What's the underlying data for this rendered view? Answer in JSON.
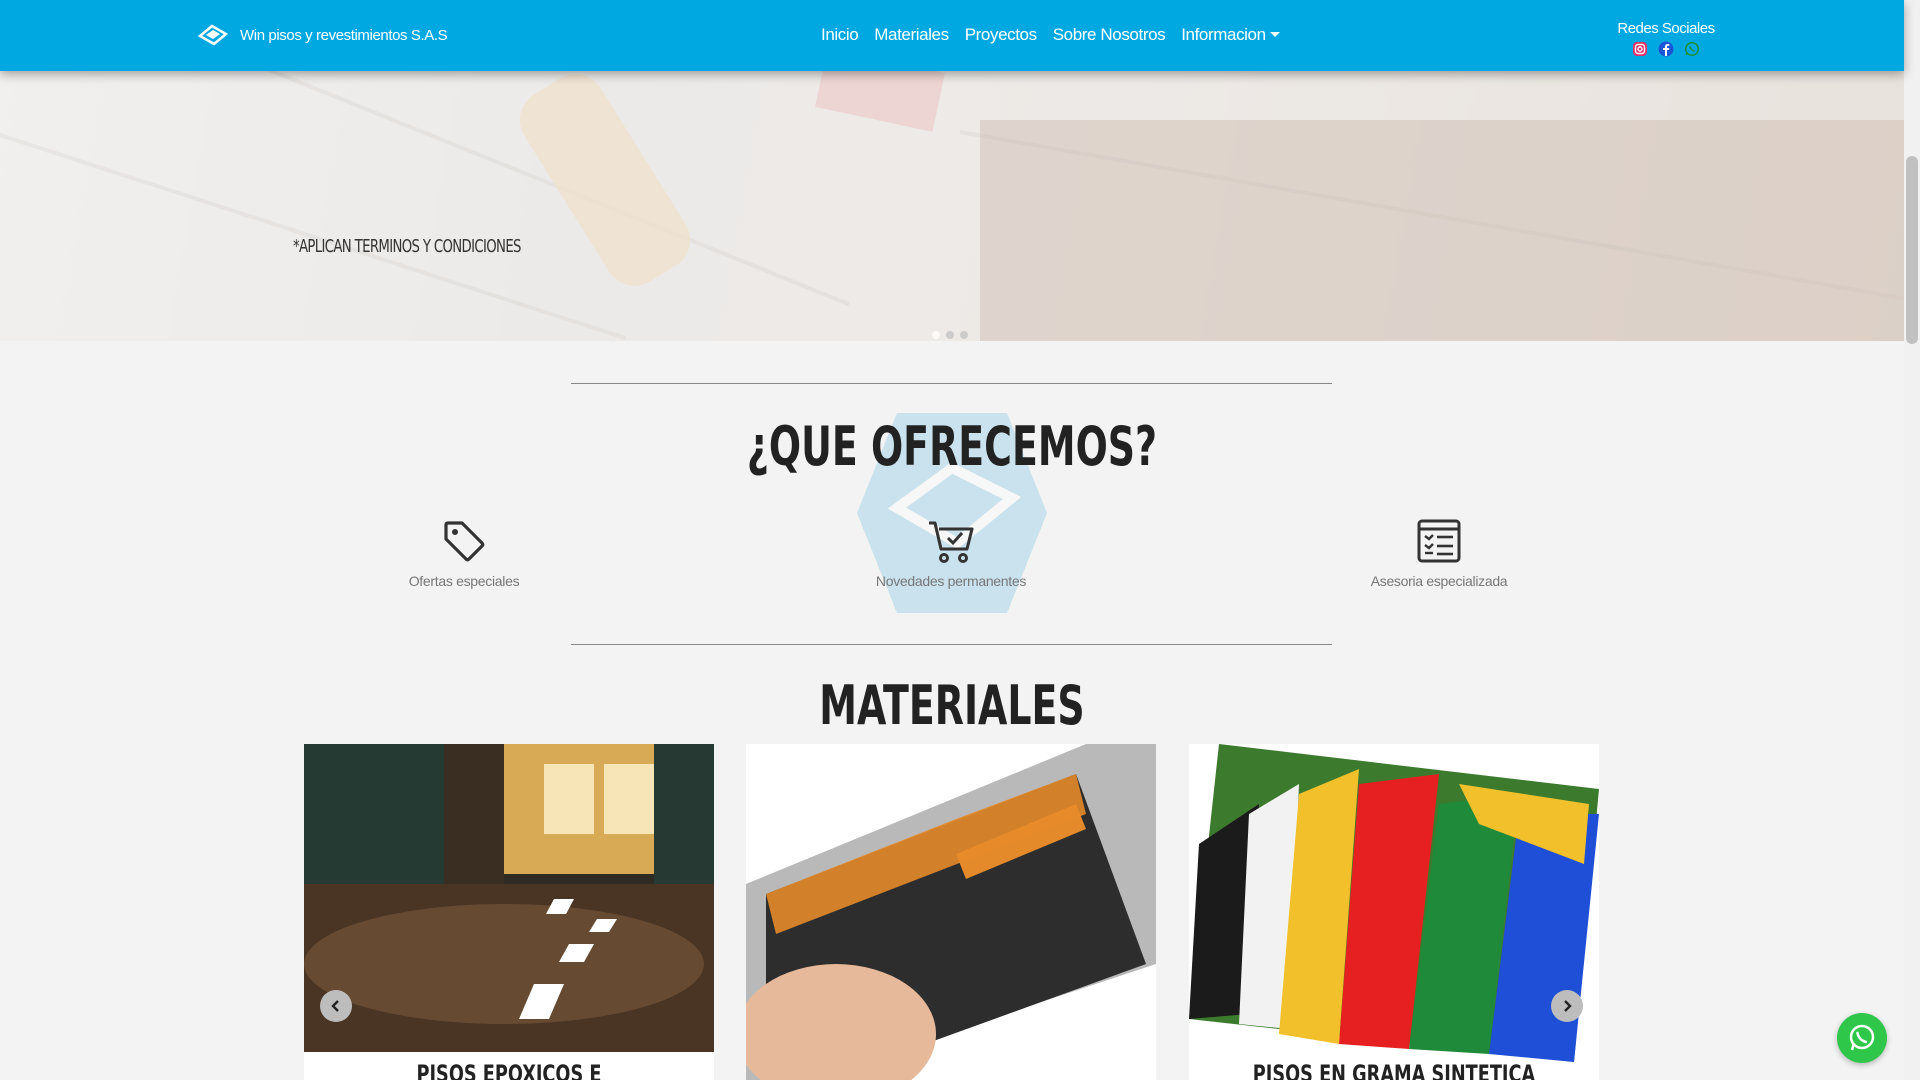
{
  "navbar": {
    "brand": "Win pisos y revestimientos S.A.S",
    "links": [
      "Inicio",
      "Materiales",
      "Proyectos",
      "Sobre Nosotros",
      "Informacion"
    ],
    "social_title": "Redes Sociales",
    "social_icons": [
      "instagram-icon",
      "facebook-icon",
      "whatsapp-icon"
    ],
    "color": "#00a8e2"
  },
  "hero": {
    "caption": "*APLICAN TERMINOS Y CONDICIONES",
    "slides": 3,
    "active_slide": 1
  },
  "offers": {
    "title": "¿QUE OFRECEMOS?",
    "items": [
      {
        "icon": "tag-icon",
        "label": "Ofertas especiales"
      },
      {
        "icon": "cart-check-icon",
        "label": "Novedades permanentes"
      },
      {
        "icon": "checklist-icon",
        "label": "Asesoria especializada"
      }
    ]
  },
  "materials": {
    "title": "MATERIALES",
    "cards": [
      {
        "title": "PISOS EPOXICOS E INDUSTRIALES",
        "image": "epoxy-floor-image"
      },
      {
        "title": "",
        "image": "rubber-tile-image"
      },
      {
        "title": "PISOS EN GRAMA SINTETICA",
        "image": "synthetic-grass-image"
      }
    ]
  },
  "whatsapp_button": {
    "icon": "whatsapp-icon",
    "color": "#2ec74a"
  }
}
